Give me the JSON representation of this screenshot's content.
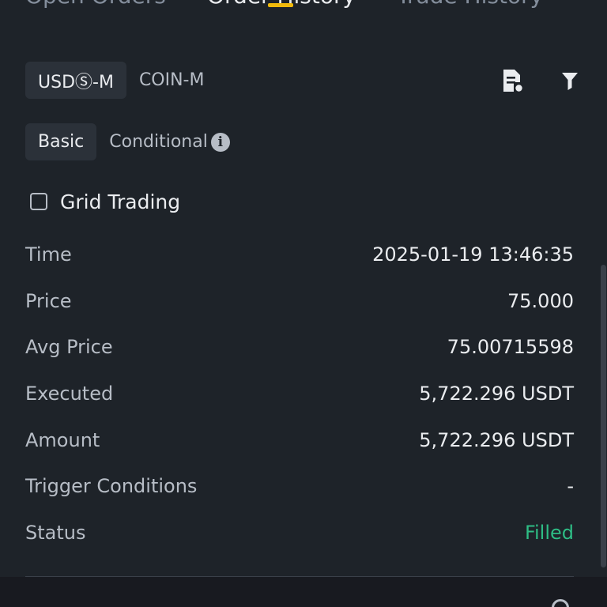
{
  "top_tabs": {
    "open_orders": "Open Orders",
    "order_history": "Order History",
    "trade_history": "Trade History"
  },
  "market_tabs": {
    "usds_m": "USDⓈ-M",
    "coin_m": "COIN-M"
  },
  "order_type_tabs": {
    "basic": "Basic",
    "conditional": "Conditional",
    "info_glyph": "i"
  },
  "grid_trading": {
    "label": "Grid Trading",
    "checked": false
  },
  "details": [
    {
      "label": "Time",
      "value": "2025-01-19 13:46:35"
    },
    {
      "label": "Price",
      "value": "75.000"
    },
    {
      "label": "Avg Price",
      "value": "75.00715598"
    },
    {
      "label": "Executed",
      "value": "5,722.296 USDT"
    },
    {
      "label": "Amount",
      "value": "5,722.296 USDT"
    },
    {
      "label": "Trigger Conditions",
      "value": "-"
    },
    {
      "label": "Status",
      "value": "Filled"
    }
  ],
  "colors": {
    "background": "#1e2329",
    "accent": "#f0b90b",
    "status_filled": "#2ebd85",
    "muted_text": "#b7bdc6"
  },
  "icons": {
    "export": "document-export-icon",
    "filter": "filter-icon",
    "info": "info-icon",
    "search": "search-icon"
  }
}
